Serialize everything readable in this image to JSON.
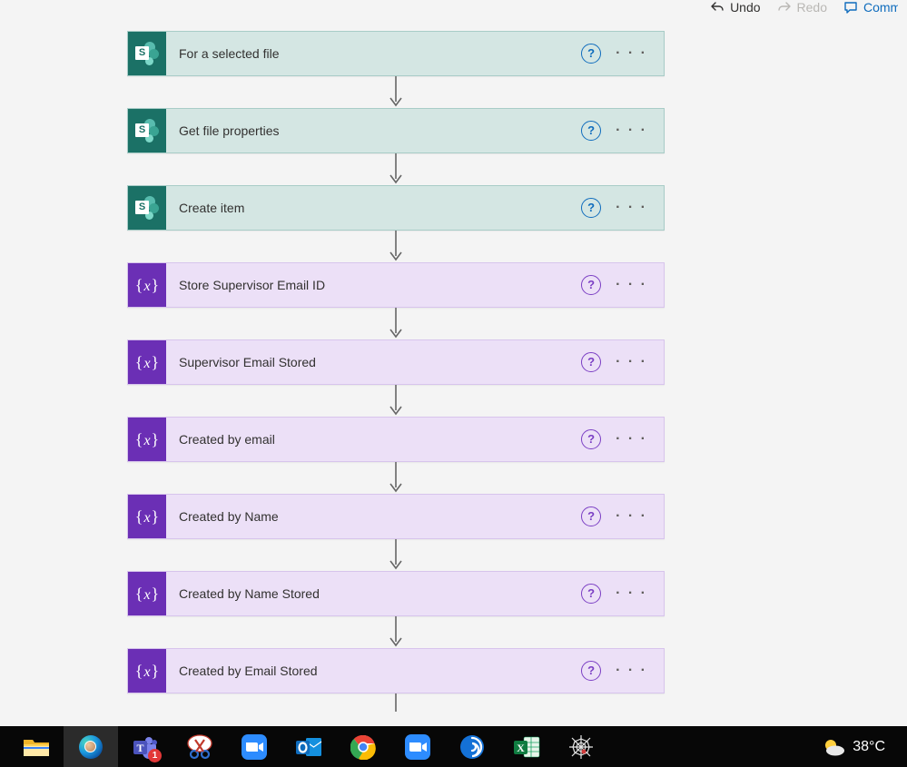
{
  "toolbar": {
    "undo": "Undo",
    "redo": "Redo",
    "comments": "Comments"
  },
  "steps": [
    {
      "kind": "sharepoint",
      "label": "For a selected file"
    },
    {
      "kind": "sharepoint",
      "label": "Get file properties"
    },
    {
      "kind": "sharepoint",
      "label": "Create item"
    },
    {
      "kind": "variable",
      "label": "Store Supervisor Email ID"
    },
    {
      "kind": "variable",
      "label": "Supervisor Email Stored"
    },
    {
      "kind": "variable",
      "label": "Created by email"
    },
    {
      "kind": "variable",
      "label": "Created by Name"
    },
    {
      "kind": "variable",
      "label": "Created by Name Stored"
    },
    {
      "kind": "variable",
      "label": "Created by Email Stored"
    }
  ],
  "weather": {
    "temp": "38°C"
  },
  "icons": {
    "sharepoint_letter": "S",
    "variable_letter": "x",
    "help": "?",
    "dots": "· · ·"
  }
}
